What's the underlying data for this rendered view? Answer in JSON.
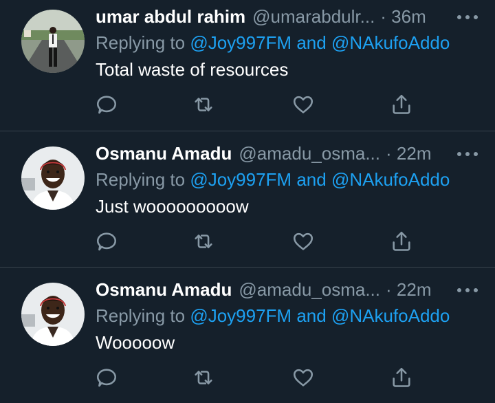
{
  "colors": {
    "background": "#15202b",
    "divider": "#38444d",
    "primary_text": "#ffffff",
    "secondary_text": "#8899a6",
    "link": "#1da1f2"
  },
  "tweets": [
    {
      "name": "umar abdul rahim",
      "handle": "@umarabdulr...",
      "time": "· 36m",
      "replying_prefix": "Replying to",
      "mention_1": "@Joy997FM",
      "conjunction": "and",
      "mention_2": "@NAkufoAddo",
      "text": "Total waste of resources",
      "avatar_icon": "avatar-photo-standing-man"
    },
    {
      "name": "Osmanu Amadu",
      "handle": "@amadu_osma...",
      "time": "· 22m",
      "replying_prefix": "Replying to",
      "mention_1": "@Joy997FM",
      "conjunction": "and",
      "mention_2": "@NAkufoAddo",
      "text": "Just wooooooooow",
      "avatar_icon": "avatar-photo-smiling-man"
    },
    {
      "name": "Osmanu Amadu",
      "handle": "@amadu_osma...",
      "time": "· 22m",
      "replying_prefix": "Replying to",
      "mention_1": "@Joy997FM",
      "conjunction": "and",
      "mention_2": "@NAkufoAddo",
      "text": "Wooooow",
      "avatar_icon": "avatar-photo-smiling-man"
    }
  ],
  "action_icons": [
    "reply-icon",
    "retweet-icon",
    "like-icon",
    "share-icon"
  ],
  "more_icon": "more-options-icon"
}
